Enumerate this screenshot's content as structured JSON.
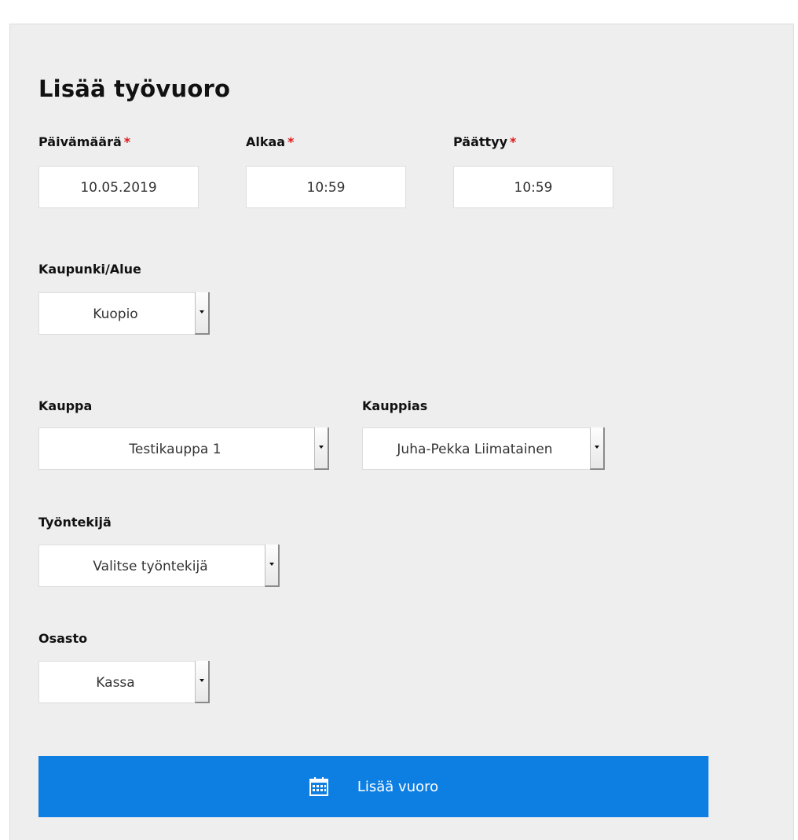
{
  "form": {
    "title": "Lisää työvuoro",
    "required_mark": "*",
    "date": {
      "label": "Päivämäärä",
      "value": "10.05.2019"
    },
    "start": {
      "label": "Alkaa",
      "value": "10:59"
    },
    "end": {
      "label": "Päättyy",
      "value": "10:59"
    },
    "city": {
      "label": "Kaupunki/Alue",
      "value": "Kuopio"
    },
    "store": {
      "label": "Kauppa",
      "value": "Testikauppa 1"
    },
    "merchant": {
      "label": "Kauppias",
      "value": "Juha-Pekka Liimatainen"
    },
    "employee": {
      "label": "Työntekijä",
      "value": "Valitse työntekijä"
    },
    "department": {
      "label": "Osasto",
      "value": "Kassa"
    },
    "submit": {
      "label": "Lisää vuoro",
      "icon": "calendar-icon"
    }
  },
  "colors": {
    "panel_bg": "#eeeeee",
    "required": "#e0191b",
    "button_bg": "#0d7fe3",
    "button_text": "#ffffff"
  }
}
